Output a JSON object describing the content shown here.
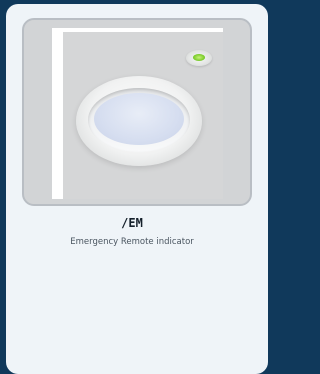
{
  "card": {
    "code": "/EM",
    "description": "Emergency Remote indicator"
  },
  "colors": {
    "background": "#10395b",
    "card": "#eff4f8",
    "image_frame": "#d2d4d6",
    "indicator_led": "#7fcf2f"
  },
  "image": {
    "subject": "emergency-remote-indicator-photo"
  }
}
